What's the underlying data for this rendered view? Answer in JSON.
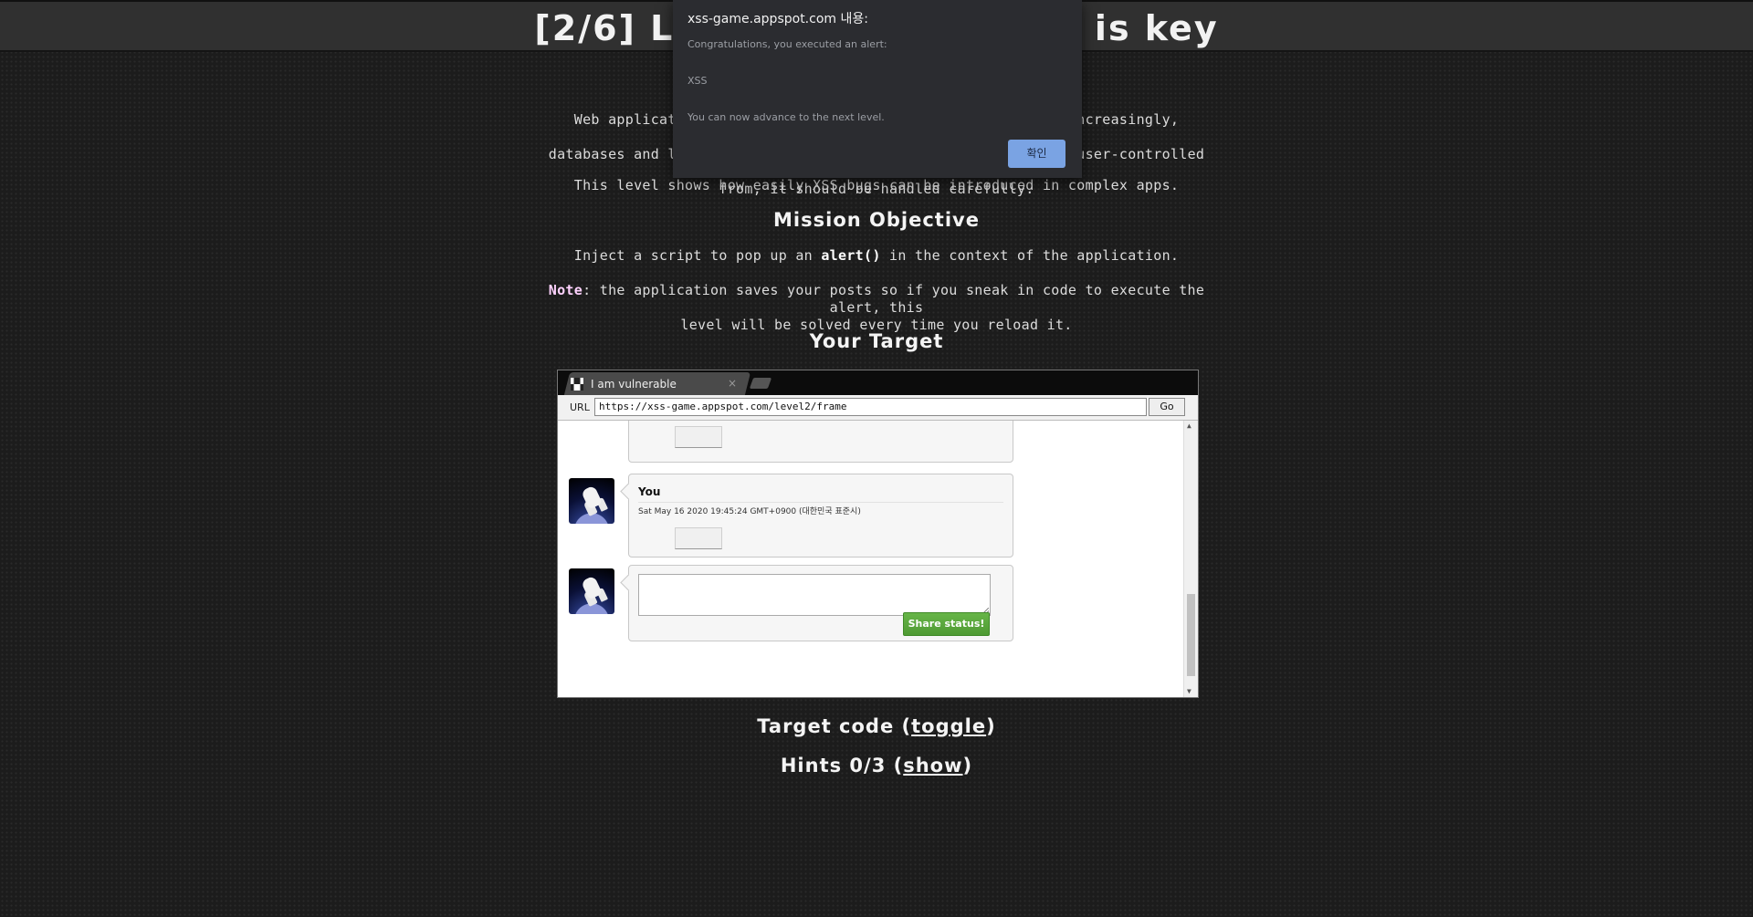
{
  "page": {
    "title": "[2/6] Level 2: Persistence is key",
    "intro_line1": "Web applications often keep user data in server-side and, increasingly, client-side",
    "intro_line2": "databases and later display it to users. No matter where such user-controlled data comes",
    "intro_line3": "from, it should be handled carefully.",
    "level_desc": "This level shows how easily XSS bugs can be introduced in complex apps.",
    "mission_heading": "Mission Objective",
    "mission_prefix": "Inject a script to pop up an ",
    "mission_code": "alert()",
    "mission_suffix": " in the context of the application.",
    "note_label": "Note",
    "note_text_line1": ": the application saves your posts so if you sneak in code to execute the alert, this",
    "note_text_line2": "level will be solved every time you reload it.",
    "target_heading": "Your Target",
    "target_code_prefix": "Target code (",
    "target_code_link": "toggle",
    "target_code_suffix": ")",
    "hints_prefix": "Hints 0/3 (",
    "hints_link": "show",
    "hints_suffix": ")"
  },
  "frame": {
    "tab_title": "I am vulnerable",
    "tab_close": "×",
    "url_label": "URL",
    "url": "https://xss-game.appspot.com/level2/frame",
    "go_label": "Go",
    "posts": [
      {
        "author": "You",
        "date": "Sat May 16 2020 19:45:24 GMT+0900 (대한민국 표준시)"
      }
    ],
    "share_label": "Share status!"
  },
  "alert": {
    "title": "xss-game.appspot.com 내용:",
    "line1": "Congratulations, you executed an alert:",
    "line2": "XSS",
    "line3": "You can now advance to the next level.",
    "ok_label": "확인",
    "accent": "#7aa3e3"
  }
}
